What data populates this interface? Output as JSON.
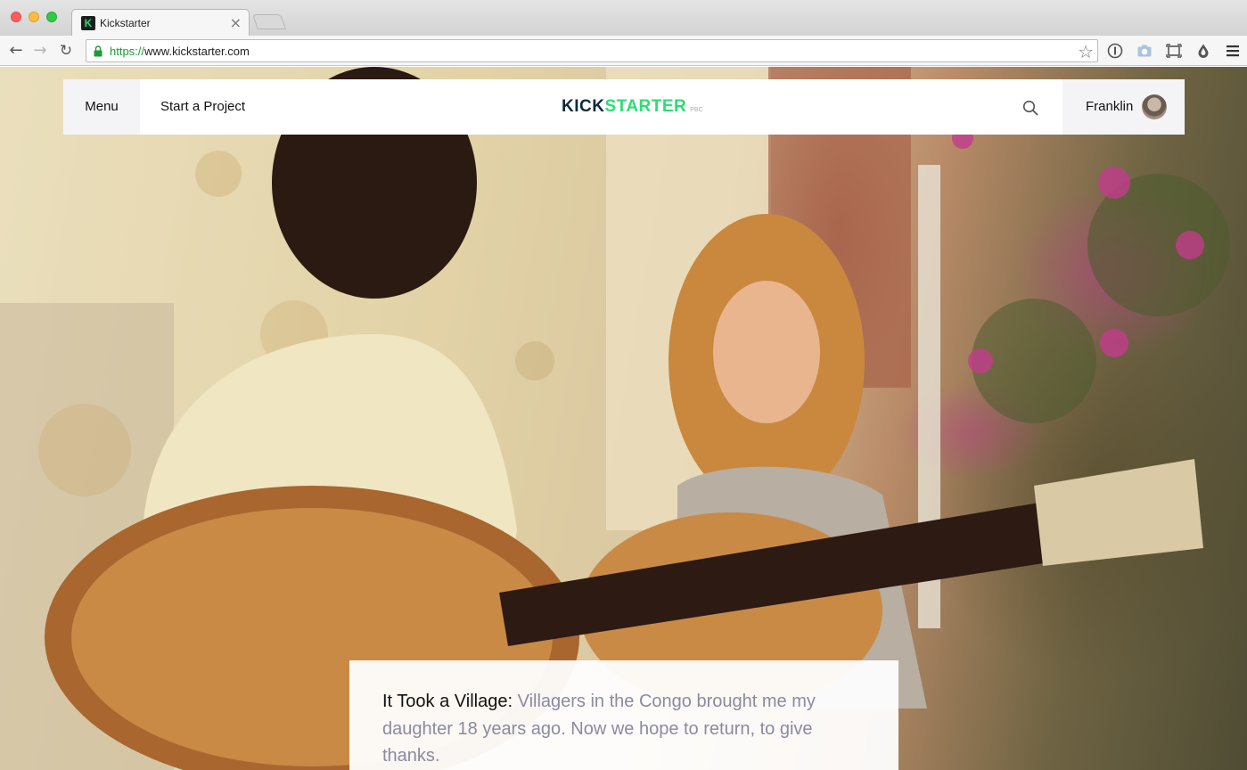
{
  "browser": {
    "tab": {
      "title": "Kickstarter",
      "favicon": "K",
      "close": "×"
    },
    "address_bar": {
      "scheme": "https://",
      "host": "www.kickstarter.com"
    },
    "icons": [
      "back-icon",
      "forward-icon",
      "reload-icon",
      "lock-icon",
      "bookmark-star-icon",
      "info-extension-icon",
      "camera-extension-icon",
      "screen-capture-extension-icon",
      "drop-extension-icon",
      "hamburger-menu-icon"
    ]
  },
  "site_header": {
    "menu_label": "Menu",
    "start_project_label": "Start a Project",
    "logo": {
      "kick": "KICK",
      "starter": "STARTER",
      "suffix": "PBC"
    },
    "user_name": "Franklin"
  },
  "feature": {
    "title": "It Took a Village:",
    "description": "Villagers in the Congo brought me my daughter 18 years ago. Now we hope to return, to give thanks."
  },
  "colors": {
    "brand_green": "#2bde73",
    "brand_navy": "#0f2b3d",
    "secure_green": "#1e9a36",
    "muted_text": "#8b8aa0"
  }
}
